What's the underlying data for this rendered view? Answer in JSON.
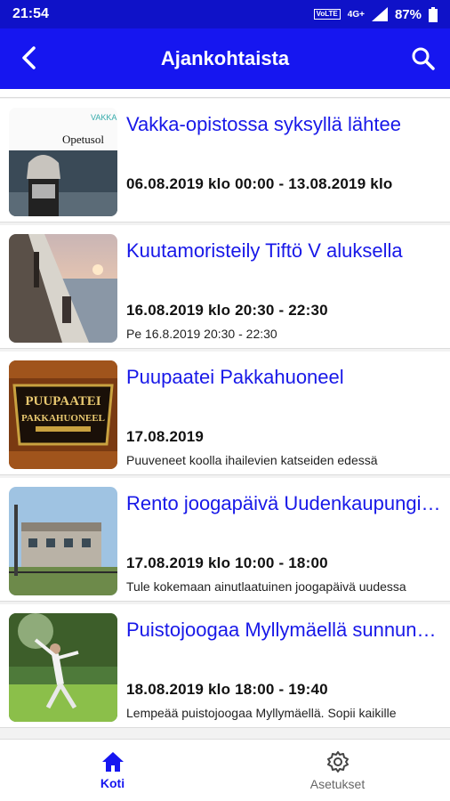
{
  "status": {
    "time": "21:54",
    "network": "4G+",
    "volte": "VoLTE",
    "battery": "87%"
  },
  "appbar": {
    "title": "Ajankohtaista"
  },
  "thumb_texts": {
    "item0_brand": "VAKKA",
    "item0_sub": "Opetusol",
    "item2_sign_line1": "PUUPAATEI",
    "item2_sign_line2": "PAKKAHUONEEL"
  },
  "items": [
    {
      "title": "Vakka-opistossa syksyllä lähtee",
      "date": "06.08.2019 klo 00:00 - 13.08.2019 klo",
      "desc": ""
    },
    {
      "title": "Kuutamoristeily Tiftö V aluksella",
      "date": "16.08.2019 klo 20:30 - 22:30",
      "desc": "Pe 16.8.2019 20:30 - 22:30"
    },
    {
      "title": "Puupaatei Pakkahuoneel",
      "date": "17.08.2019",
      "desc": "Puuveneet koolla ihailevien katseiden edessä"
    },
    {
      "title": "Rento joogapäivä Uudenkaupungissa",
      "date": "17.08.2019 klo 10:00 - 18:00",
      "desc": "Tule kokemaan ainutlaatuinen joogapäivä uudessa"
    },
    {
      "title": "Puistojoogaa Myllymäellä sunnuntaina",
      "date": "18.08.2019 klo 18:00 - 19:40",
      "desc": "Lempeää puistojoogaa Myllymäellä. Sopii kaikille"
    }
  ],
  "nav": {
    "home_label": "Koti",
    "settings_label": "Asetukset"
  },
  "colors": {
    "primary": "#1616f0",
    "link": "#1818e8"
  }
}
